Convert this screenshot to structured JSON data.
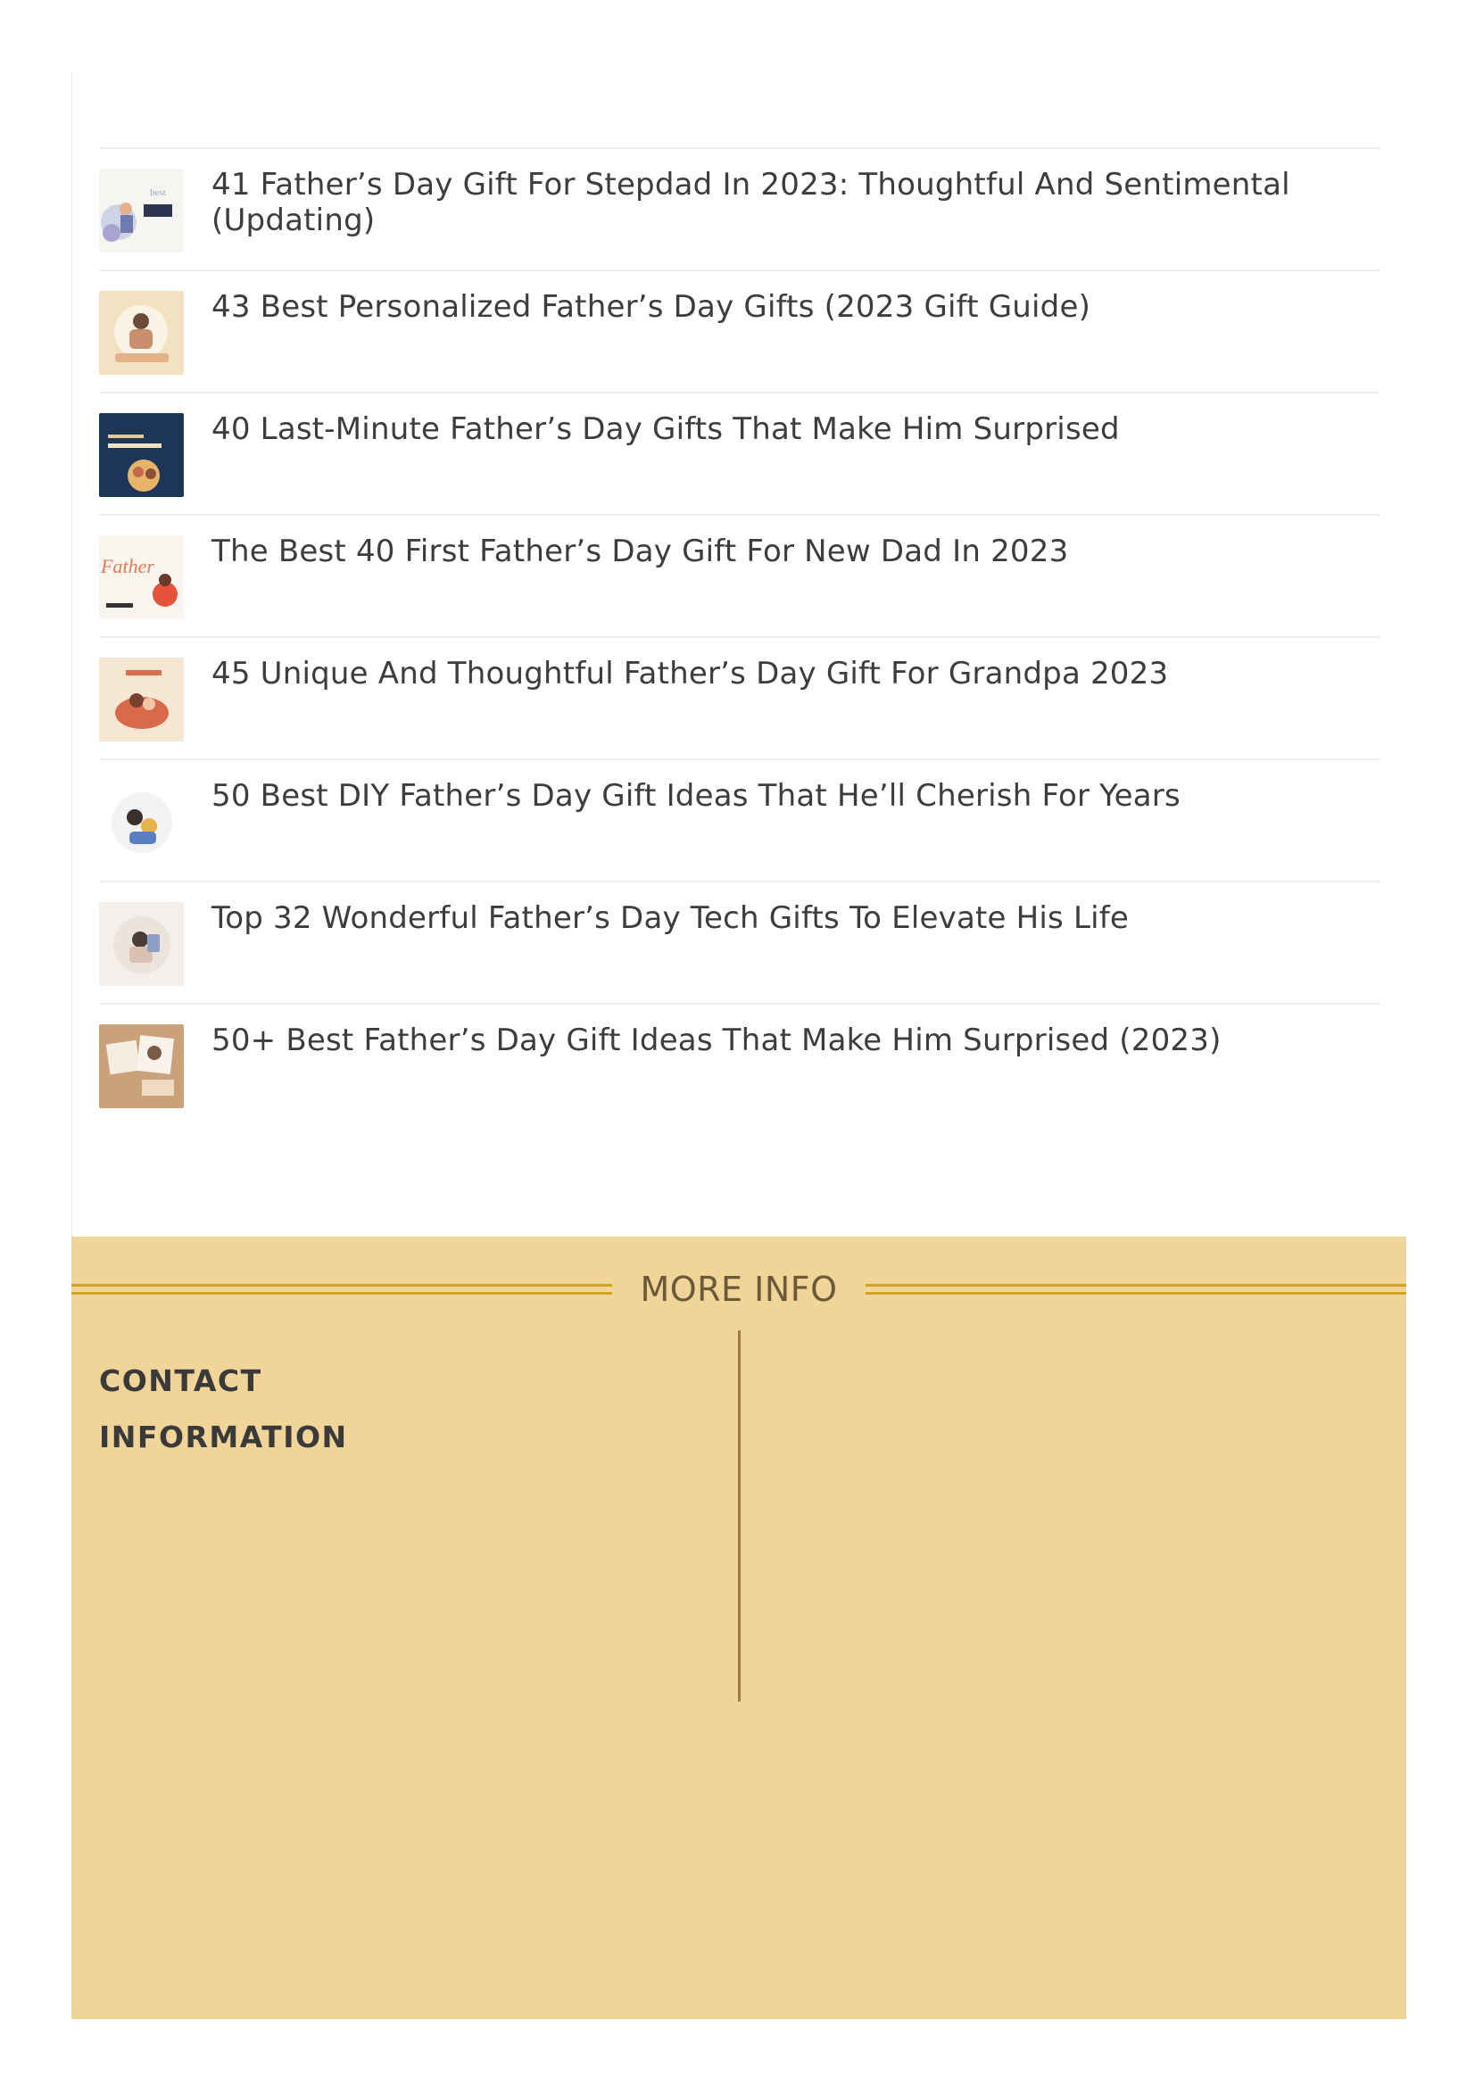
{
  "related_posts": [
    {
      "title": "41 Father’s Day Gift For Stepdad In 2023: Thoughtful And Sentimental (Updating)",
      "thumb_icon": "best-dad-card-thumbnail"
    },
    {
      "title": "43 Best Personalized Father’s Day Gifts (2023 Gift Guide)",
      "thumb_icon": "dad-child-portrait-thumbnail"
    },
    {
      "title": "40 Last-Minute Father’s Day Gifts That Make Him Surprised",
      "thumb_icon": "last-minute-gifts-navy-thumbnail"
    },
    {
      "title": "The Best 40 First Father’s Day Gift For New Dad In 2023",
      "thumb_icon": "happy-fathers-day-lettering-thumbnail"
    },
    {
      "title": "45 Unique And Thoughtful Father’s Day Gift For Grandpa 2023",
      "thumb_icon": "grandpa-sofa-thumbnail"
    },
    {
      "title": "50 Best DIY Father’s Day Gift Ideas That He’ll Cherish For Years",
      "thumb_icon": "diy-gift-circle-thumbnail"
    },
    {
      "title": "Top 32 Wonderful Father’s Day Tech Gifts To Elevate His Life",
      "thumb_icon": "tech-gifts-circle-thumbnail"
    },
    {
      "title": "50+ Best Father’s Day Gift Ideas That Make Him Surprised (2023)",
      "thumb_icon": "photo-collage-thumbnail"
    }
  ],
  "footer": {
    "title": "MORE INFO",
    "contact_heading": "CONTACT INFORMATION"
  },
  "colors": {
    "footer_bg": "#f1d497",
    "accent_lines": "#d2a326",
    "divider": "#9c7c44"
  }
}
